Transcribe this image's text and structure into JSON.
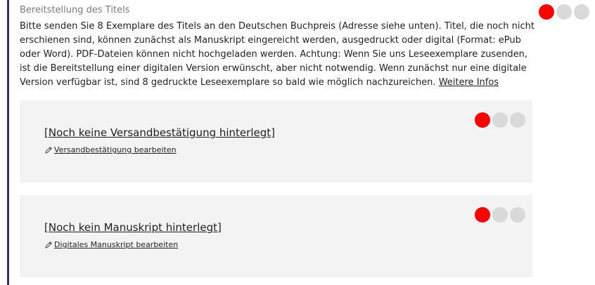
{
  "section": {
    "title": "Bereitstellung des Titels",
    "description": "Bitte senden Sie 8 Exemplare des Titels an den Deutschen Buchpreis (Adresse siehe unten). Titel, die noch nicht erschienen sind, können zunächst als Manuskript eingereicht werden, ausgedruckt oder digital (Format: ePub oder Word). PDF-Dateien können nicht hochgeladen werden. Achtung: Wenn Sie uns Leseexemplare zusenden, ist die Bereitstellung einer digitalen Version erwünscht, aber nicht notwendig. Wenn zunächst nur eine digitale Version verfügbar ist, sind 8 gedruckte Leseexemplare so bald wie möglich nachzureichen.",
    "more_link": "Weitere Infos",
    "status": {
      "active_step": 1,
      "total_steps": 3
    }
  },
  "cards": [
    {
      "title": "[Noch keine Versandbestätigung hinterlegt]",
      "edit_label": "Versandbestätigung bearbeiten",
      "status": {
        "active_step": 1,
        "total_steps": 3
      }
    },
    {
      "title": "[Noch kein Manuskript hinterlegt]",
      "edit_label": "Digitales Manuskript bearbeiten",
      "status": {
        "active_step": 1,
        "total_steps": 3
      }
    }
  ],
  "colors": {
    "status_active": "#ff0000",
    "status_inactive": "#d9d9d9",
    "left_rule": "#3a2a6e",
    "card_background": "#f3f3f3"
  },
  "icons": {
    "edit": "pencil-icon"
  }
}
